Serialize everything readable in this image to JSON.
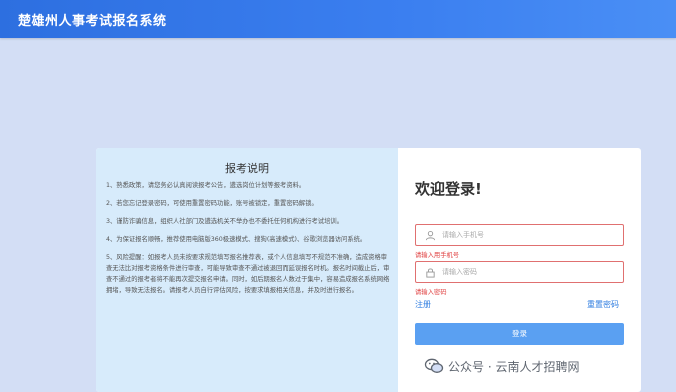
{
  "app": {
    "title": "楚雄州人事考试报名系统"
  },
  "notice": {
    "title": "报考说明",
    "items": [
      "1、熟悉政策，请您务必认真阅读报考公告，遴选岗位计划等报考资料。",
      "2、若您忘记登录密码，可使用重置密码功能，账号被锁定，重置密码解锁。",
      "3、谨防诈骗信息，组织人社部门及遴选机关不举办也不委托任何机构进行考试培训。",
      "4、为保证报名顺畅，推荐使用电脑版360极速模式、搜狗(高速模式)、谷歌浏览器访问系统。",
      "5、风险提醒：如报考人员未按要求规范填写报名推荐表，或个人信息填写不规范不准确，造成资格审查无法比对报考资格条件进行审查，可能导致审查不通过被退回而延误报名时机。报名时间截止后，审查不通过的报考者将不能再次提交报名申请。同时，如后期报名人数过于集中，容易造成报名系统网络拥堵，导致无法报名。请报考人员自行评估风险，按要求填报相关信息，并及时进行报名。"
    ]
  },
  "login": {
    "welcome": "欢迎登录!",
    "phone_placeholder": "请输入手机号",
    "phone_error": "请输入用手机号",
    "password_placeholder": "请输入密码",
    "password_error": "请输入密码",
    "register": "注册",
    "reset_password": "重置密码",
    "submit": "登录"
  },
  "watermark": {
    "text": "公众号 · 云南人才招聘网"
  },
  "colors": {
    "topbar": "#3b7ff0",
    "accent": "#2f7de0",
    "button": "#5aa0f2",
    "error": "#e04040"
  }
}
